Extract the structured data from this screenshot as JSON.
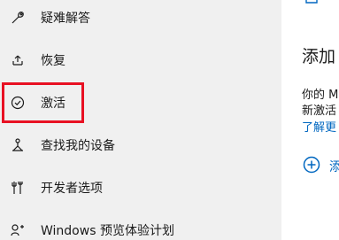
{
  "sidebar": {
    "items": [
      {
        "label": "疑难解答",
        "icon": "wrench-icon"
      },
      {
        "label": "恢复",
        "icon": "recovery-icon"
      },
      {
        "label": "激活",
        "icon": "check-circle-icon",
        "selected": true
      },
      {
        "label": "查找我的设备",
        "icon": "find-device-icon"
      },
      {
        "label": "开发者选项",
        "icon": "developer-tools-icon"
      },
      {
        "label": "Windows 预览体验计划",
        "icon": "insider-icon"
      }
    ]
  },
  "content": {
    "title": "添加",
    "text_line_1": "你的 M",
    "text_line_2": "新激活",
    "link": "了解更",
    "add_label": "添"
  },
  "colors": {
    "sidebar_bg": "#f0f0f0",
    "accent": "#0067c0",
    "highlight_border": "#e81123",
    "text": "#1a1a1a"
  }
}
